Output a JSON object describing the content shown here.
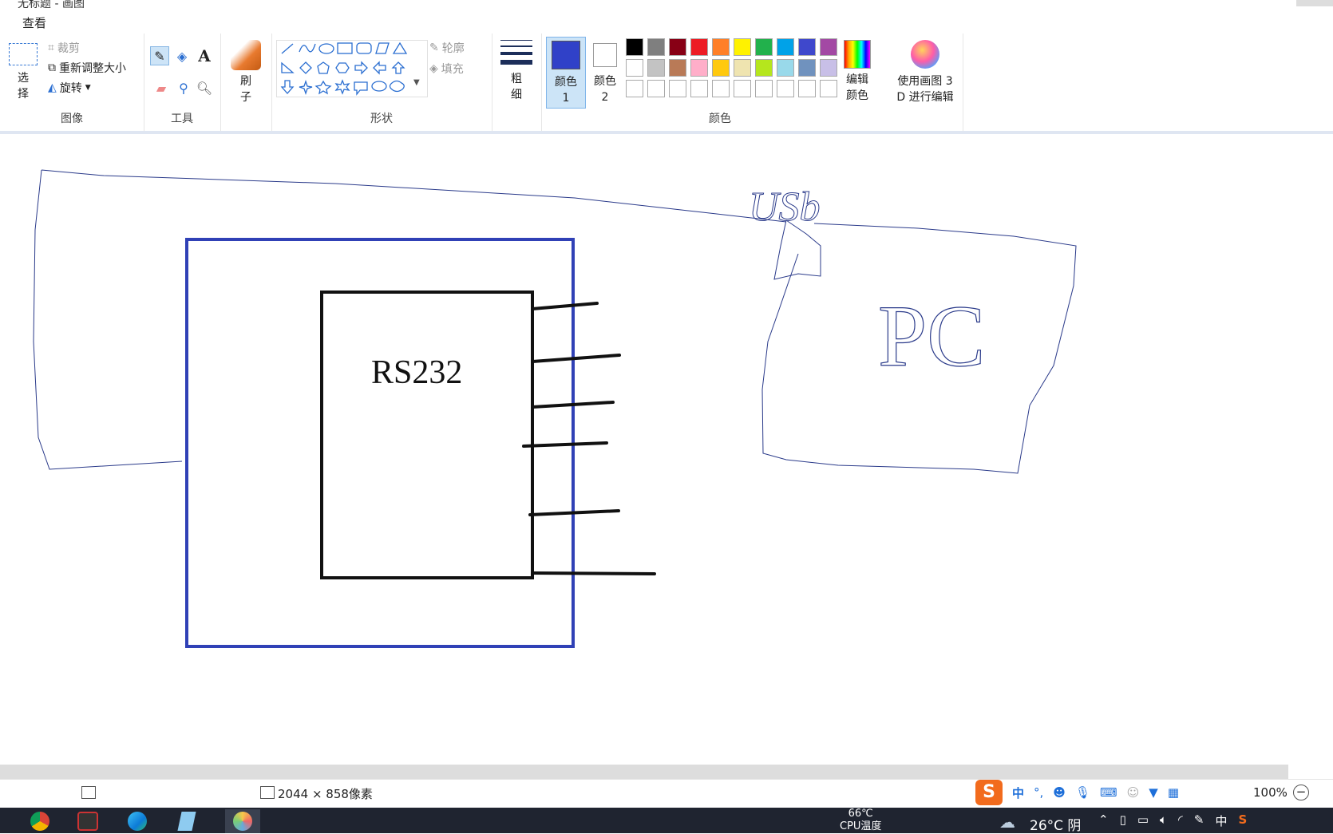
{
  "window": {
    "title": "无标题 - 画图"
  },
  "menu": {
    "view": "查看"
  },
  "ribbon": {
    "image": {
      "label": "图像",
      "select": "选择",
      "crop": "裁剪",
      "resize": "重新调整大小",
      "rotate": "旋转"
    },
    "tools": {
      "label": "工具"
    },
    "brush": {
      "label": "刷子"
    },
    "shapes": {
      "label": "形状",
      "outline": "轮廓",
      "fill": "填充"
    },
    "size": {
      "label": "粗细"
    },
    "colors": {
      "label": "颜色",
      "color1": "颜色 1",
      "color2": "颜色 2",
      "edit": "编辑颜色",
      "paint3d": "使用画图 3 D 进行编辑",
      "palette_row1": [
        "#000000",
        "#7f7f7f",
        "#880015",
        "#ed1c24",
        "#ff7f27",
        "#fff200",
        "#22b14c",
        "#00a2e8",
        "#3f48cc",
        "#a349a4"
      ],
      "palette_row2": [
        "#ffffff",
        "#c3c3c3",
        "#b97a57",
        "#ffaec9",
        "#ffc90e",
        "#efe4b0",
        "#b5e61d",
        "#99d9ea",
        "#7092be",
        "#c8bfe7"
      ],
      "color1_value": "#3041c8",
      "color2_value": "#ffffff"
    }
  },
  "canvas": {
    "chip_label": "RS232",
    "usb_label": "USb",
    "pc_label": "PC"
  },
  "status": {
    "dimensions": "2044 × 858像素",
    "zoom": "100%"
  },
  "taskbar": {
    "cpu_temp": "66℃",
    "cpu_label": "CPU温度",
    "weather": "26°C 阴",
    "ime": "中"
  }
}
